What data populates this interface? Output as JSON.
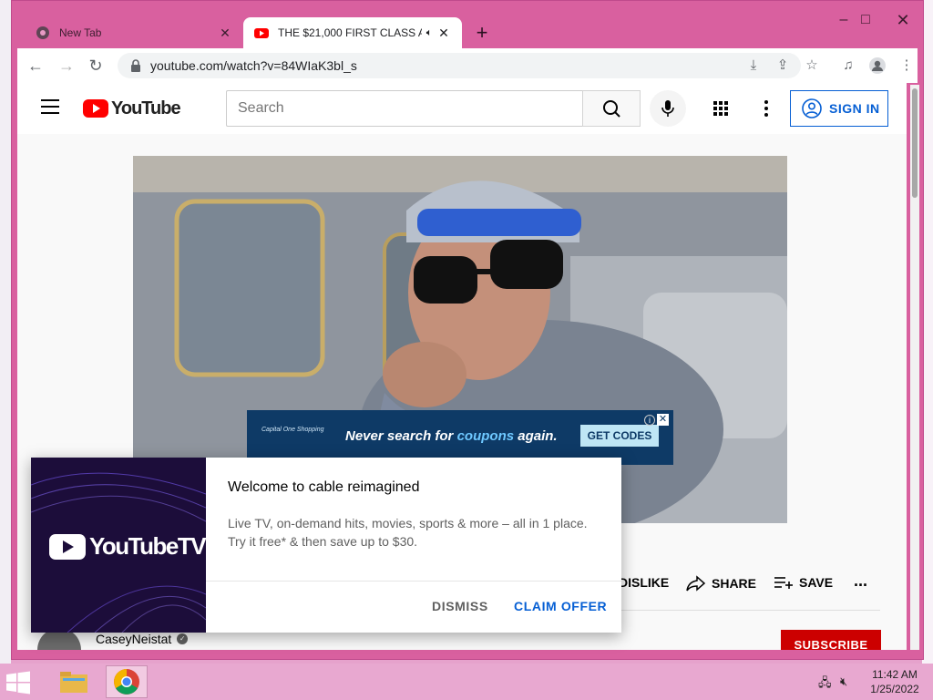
{
  "browser": {
    "tabs": [
      {
        "title": "New Tab",
        "active": false
      },
      {
        "title": "THE $21,000 FIRST CLASS AI",
        "active": true,
        "audio": true
      }
    ],
    "new_tab_symbol": "+",
    "url": "youtube.com/watch?v=84WIaK3bl_s",
    "window_controls": {
      "minimize": "–",
      "maximize": "□",
      "close": "✕"
    }
  },
  "youtube": {
    "logo_text": "YouTube",
    "search_placeholder": "Search",
    "sign_in_label": "SIGN IN",
    "ad": {
      "brand": "Capital One Shopping",
      "message_prefix": "Never search for ",
      "message_highlight": "coupons",
      "message_suffix": " again.",
      "cta": "GET CODES"
    },
    "actions": {
      "dislike": "DISLIKE",
      "share": "SHARE",
      "save": "SAVE",
      "more": "..."
    },
    "channel_name": "CaseyNeistat",
    "subscribe_label": "SUBSCRIBE"
  },
  "promo": {
    "logo_text": "YouTubeTV",
    "title": "Welcome to cable reimagined",
    "description_line1": "Live TV, on-demand hits, movies, sports & more – all in 1 place.",
    "description_line2": "Try it free* & then save up to $30.",
    "dismiss_label": "DISMISS",
    "claim_label": "CLAIM OFFER"
  },
  "taskbar": {
    "time": "11:42 AM",
    "date": "1/25/2022"
  },
  "colors": {
    "window_frame": "#d9609f",
    "youtube_red": "#ff0000",
    "link_blue": "#065fd4",
    "subscribe_red": "#cc0000",
    "ad_background": "#0e3a66",
    "taskbar": "#e8a8d0"
  }
}
